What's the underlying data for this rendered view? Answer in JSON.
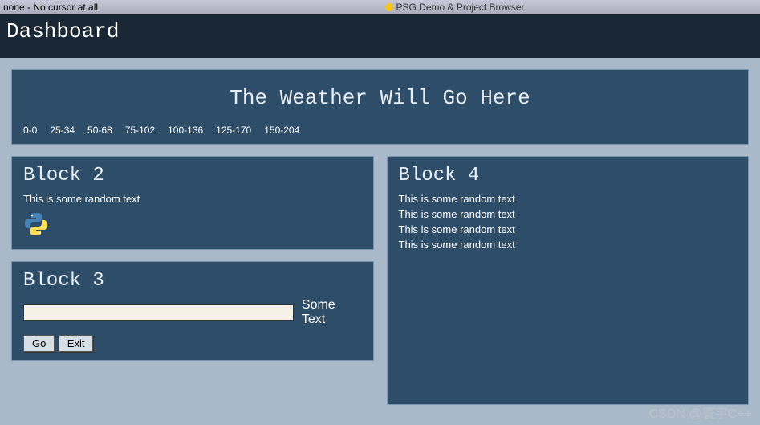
{
  "titlebar": {
    "left": "none - No cursor at all",
    "right": "PSG Demo & Project Browser"
  },
  "header": {
    "title": "Dashboard"
  },
  "weather": {
    "title": "The Weather Will Go Here",
    "ranges": [
      "0-0",
      "25-34",
      "50-68",
      "75-102",
      "100-136",
      "125-170",
      "150-204"
    ]
  },
  "block2": {
    "title": "Block 2",
    "text": "This is some random text"
  },
  "block3": {
    "title": "Block 3",
    "input_value": "",
    "label": "Some Text",
    "go": "Go",
    "exit": "Exit"
  },
  "block4": {
    "title": "Block 4",
    "lines": [
      "This is some random text",
      "This is some random text",
      "This is some random text",
      "This is some random text"
    ]
  },
  "watermark": "CSDN @寰宇C++"
}
